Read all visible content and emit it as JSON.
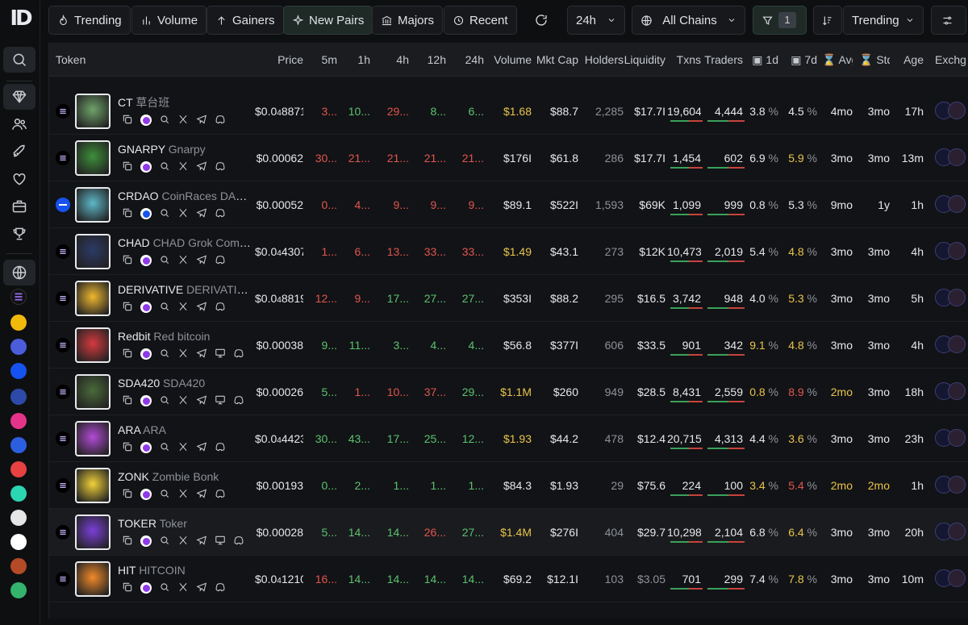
{
  "toolbar": {
    "buttons": [
      {
        "label": "Trending",
        "icon": "flame-icon"
      },
      {
        "label": "Volume",
        "icon": "bar-chart-icon"
      },
      {
        "label": "Gainers",
        "icon": "arrow-up-icon"
      },
      {
        "label": "New Pairs",
        "icon": "sparkle-icon"
      },
      {
        "label": "Majors",
        "icon": "bank-icon"
      },
      {
        "label": "Recent",
        "icon": "history-icon"
      }
    ],
    "timeframe": "24h",
    "chains": "All Chains",
    "filter_count": "1",
    "sort": "Trending"
  },
  "columns": [
    "Token",
    "Price",
    "5m",
    "1h",
    "4h",
    "12h",
    "24h",
    "Volume",
    "Mkt Cap",
    "Holders",
    "Liquidity",
    "Txns",
    "Traders",
    "1d",
    "7d",
    "Avg",
    "Std",
    "Age",
    "Exchg"
  ],
  "colors": {
    "green": "#5ac36f",
    "red": "#e2554e",
    "yellow": "#e8c44b",
    "accent": "#2f3e39"
  },
  "rows": [
    {
      "symbol": "CT",
      "name": "草台班",
      "chain": "solana",
      "price_prefix": "$0.0",
      "price_sub": "4",
      "price_rest": "8871",
      "p5m": "3...",
      "p1h": "10...",
      "p4h": "29...",
      "p12h": "8...",
      "p24h": "6...",
      "c5m": "red",
      "c1h": "green",
      "c4h": "red",
      "c12h": "green",
      "c24h": "green",
      "volume": "$1.68",
      "vol_color": "yellow",
      "mcap": "$88.7",
      "holders": "2,285",
      "liquidity": "$17.7I",
      "txns": "19,604",
      "traders": "4,444",
      "d1": "3.8",
      "d7": "4.5",
      "d1c": "white",
      "d7c": "white",
      "avg": "4mo",
      "std": "3mo",
      "age": "17h",
      "avatar_color": "#6fa36a"
    },
    {
      "symbol": "GNARPY",
      "name": "Gnarpy",
      "chain": "solana",
      "price_prefix": "$0.00062",
      "price_sub": "",
      "price_rest": "",
      "p5m": "30...",
      "p1h": "21...",
      "p4h": "21...",
      "p12h": "21...",
      "p24h": "21...",
      "c5m": "red",
      "c1h": "red",
      "c4h": "red",
      "c12h": "red",
      "c24h": "red",
      "volume": "$176I",
      "vol_color": "white",
      "mcap": "$61.8",
      "holders": "286",
      "liquidity": "$17.7I",
      "txns": "1,454",
      "traders": "602",
      "d1": "6.9",
      "d7": "5.9",
      "d1c": "white",
      "d7c": "yellow",
      "avg": "3mo",
      "std": "3mo",
      "age": "13m",
      "avatar_color": "#3d8f3a"
    },
    {
      "symbol": "CRDAO",
      "name": "CoinRaces DAO ...",
      "chain": "base",
      "price_prefix": "$0.00052",
      "price_sub": "",
      "price_rest": "",
      "p5m": "0...",
      "p1h": "4...",
      "p4h": "9...",
      "p12h": "9...",
      "p24h": "9...",
      "c5m": "red",
      "c1h": "red",
      "c4h": "red",
      "c12h": "red",
      "c24h": "red",
      "volume": "$89.1",
      "vol_color": "white",
      "mcap": "$522I",
      "holders": "1,593",
      "liquidity": "$69K",
      "txns": "1,099",
      "traders": "999",
      "d1": "0.8",
      "d7": "5.3",
      "d1c": "white",
      "d7c": "white",
      "avg": "9mo",
      "std": "1y",
      "age": "1h",
      "avatar_color": "#5fb8c9"
    },
    {
      "symbol": "CHAD",
      "name": "CHAD Grok Comp...",
      "chain": "solana",
      "price_prefix": "$0.0",
      "price_sub": "4",
      "price_rest": "4307",
      "p5m": "1...",
      "p1h": "6...",
      "p4h": "13...",
      "p12h": "33...",
      "p24h": "33...",
      "c5m": "red",
      "c1h": "red",
      "c4h": "red",
      "c12h": "red",
      "c24h": "red",
      "volume": "$1.49",
      "vol_color": "yellow",
      "mcap": "$43.1",
      "holders": "273",
      "liquidity": "$12K",
      "txns": "10,473",
      "traders": "2,019",
      "d1": "5.4",
      "d7": "4.8",
      "d1c": "white",
      "d7c": "yellow",
      "avg": "3mo",
      "std": "3mo",
      "age": "4h",
      "avatar_color": "#2c3a66"
    },
    {
      "symbol": "DERIVATIVE",
      "name": "DERIVATIVE ...",
      "chain": "solana",
      "price_prefix": "$0.0",
      "price_sub": "4",
      "price_rest": "8819",
      "p5m": "12...",
      "p1h": "9...",
      "p4h": "17...",
      "p12h": "27...",
      "p24h": "27...",
      "c5m": "red",
      "c1h": "red",
      "c4h": "green",
      "c12h": "green",
      "c24h": "green",
      "volume": "$353I",
      "vol_color": "white",
      "mcap": "$88.2",
      "holders": "295",
      "liquidity": "$16.5",
      "txns": "3,742",
      "traders": "948",
      "d1": "4.0",
      "d7": "5.3",
      "d1c": "white",
      "d7c": "yellow",
      "avg": "3mo",
      "std": "3mo",
      "age": "5h",
      "avatar_color": "#f0b830"
    },
    {
      "symbol": "Redbit",
      "name": "Red bitcoin",
      "chain": "solana",
      "price_prefix": "$0.00038",
      "price_sub": "",
      "price_rest": "",
      "p5m": "9...",
      "p1h": "11...",
      "p4h": "3...",
      "p12h": "4...",
      "p24h": "4...",
      "c5m": "green",
      "c1h": "green",
      "c4h": "green",
      "c12h": "green",
      "c24h": "green",
      "volume": "$56.8",
      "vol_color": "white",
      "mcap": "$377I",
      "holders": "606",
      "liquidity": "$33.5",
      "txns": "901",
      "traders": "342",
      "d1": "9.1",
      "d7": "4.8",
      "d1c": "yellow",
      "d7c": "yellow",
      "avg": "3mo",
      "std": "3mo",
      "age": "4h",
      "avatar_color": "#d63a3f"
    },
    {
      "symbol": "SDA420",
      "name": "SDA420",
      "chain": "solana",
      "price_prefix": "$0.00026",
      "price_sub": "",
      "price_rest": "",
      "p5m": "5...",
      "p1h": "1...",
      "p4h": "10...",
      "p12h": "37...",
      "p24h": "29...",
      "c5m": "green",
      "c1h": "red",
      "c4h": "red",
      "c12h": "red",
      "c24h": "green",
      "volume": "$1.1M",
      "vol_color": "yellow",
      "mcap": "$260",
      "holders": "949",
      "liquidity": "$28.5",
      "txns": "8,431",
      "traders": "2,559",
      "d1": "0.8",
      "d7": "8.9",
      "d1c": "yellow",
      "d7c": "red",
      "avg": "2mo",
      "std": "3mo",
      "age": "18h",
      "avatar_color": "#4a6a3a"
    },
    {
      "symbol": "ARA",
      "name": "ARA",
      "chain": "solana",
      "price_prefix": "$0.0",
      "price_sub": "4",
      "price_rest": "4423",
      "p5m": "30...",
      "p1h": "43...",
      "p4h": "17...",
      "p12h": "25...",
      "p24h": "12...",
      "c5m": "green",
      "c1h": "green",
      "c4h": "green",
      "c12h": "green",
      "c24h": "green",
      "volume": "$1.93",
      "vol_color": "yellow",
      "mcap": "$44.2",
      "holders": "478",
      "liquidity": "$12.4",
      "txns": "20,715",
      "traders": "4,313",
      "d1": "4.4",
      "d7": "3.6",
      "d1c": "white",
      "d7c": "yellow",
      "avg": "3mo",
      "std": "3mo",
      "age": "23h",
      "avatar_color": "#b34bd6"
    },
    {
      "symbol": "ZONK",
      "name": "Zombie Bonk",
      "chain": "solana",
      "price_prefix": "$0.00193",
      "price_sub": "",
      "price_rest": "",
      "p5m": "0...",
      "p1h": "2...",
      "p4h": "1...",
      "p12h": "1...",
      "p24h": "1...",
      "c5m": "green",
      "c1h": "green",
      "c4h": "green",
      "c12h": "green",
      "c24h": "green",
      "volume": "$84.3",
      "vol_color": "white",
      "mcap": "$1.93",
      "holders": "29",
      "liquidity": "$75.6",
      "txns": "224",
      "traders": "100",
      "d1": "3.4",
      "d7": "5.4",
      "d1c": "yellow",
      "d7c": "red",
      "avg": "2mo",
      "std": "2mo",
      "age": "1h",
      "avatar_color": "#f2d23a"
    },
    {
      "symbol": "TOKER",
      "name": "Toker",
      "chain": "solana",
      "price_prefix": "$0.00028",
      "price_sub": "",
      "price_rest": "",
      "p5m": "5...",
      "p1h": "14...",
      "p4h": "14...",
      "p12h": "26...",
      "p24h": "27...",
      "c5m": "green",
      "c1h": "green",
      "c4h": "green",
      "c12h": "red",
      "c24h": "green",
      "volume": "$1.4M",
      "vol_color": "yellow",
      "mcap": "$276I",
      "holders": "404",
      "liquidity": "$29.7",
      "txns": "10,298",
      "traders": "2,104",
      "d1": "6.8",
      "d7": "6.4",
      "d1c": "white",
      "d7c": "yellow",
      "avg": "3mo",
      "std": "3mo",
      "age": "20h",
      "avatar_color": "#7b3fd9"
    },
    {
      "symbol": "HIT",
      "name": "HITCOIN",
      "chain": "solana",
      "price_prefix": "$0.0",
      "price_sub": "4",
      "price_rest": "1210",
      "p5m": "16...",
      "p1h": "14...",
      "p4h": "14...",
      "p12h": "14...",
      "p24h": "14...",
      "c5m": "red",
      "c1h": "green",
      "c4h": "green",
      "c12h": "green",
      "c24h": "green",
      "volume": "$69.2",
      "vol_color": "white",
      "mcap": "$12.1I",
      "holders": "103",
      "liquidity": "$3.05",
      "txns": "701",
      "traders": "299",
      "d1": "7.4",
      "d7": "7.8",
      "d1c": "white",
      "d7c": "yellow",
      "avg": "3mo",
      "std": "3mo",
      "age": "10m",
      "avatar_color": "#f28a2a"
    }
  ]
}
